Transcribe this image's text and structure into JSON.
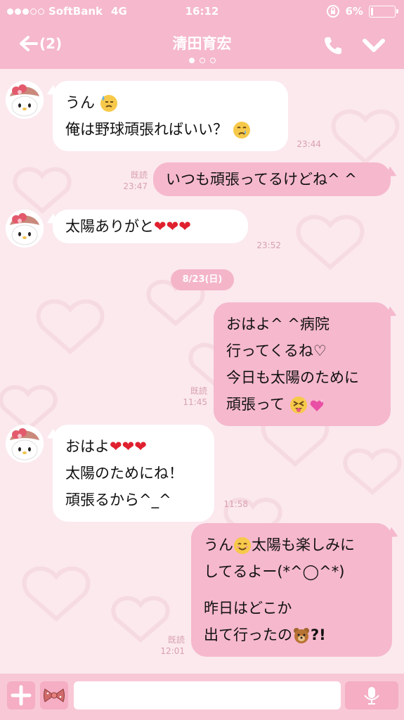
{
  "status_bar": {
    "carrier": "SoftBank",
    "network": "4G",
    "time": "16:12",
    "battery": "6%"
  },
  "nav": {
    "back_label": "(2)",
    "title": "清田育宏"
  },
  "colors": {
    "header": "#f5b8cc",
    "outgoing_bubble": "#f6b8cd",
    "incoming_bubble": "#ffffff",
    "background": "#fbe9ee",
    "meta_text": "#d9a0b0"
  },
  "messages": [
    {
      "direction": "in",
      "lines": [
        "うん",
        "俺は野球頑張ればいい？"
      ],
      "time": "23:44"
    },
    {
      "direction": "out",
      "lines": [
        "いつも頑張ってるけどね^ ^"
      ],
      "read": "既読",
      "time": "23:47"
    },
    {
      "direction": "in",
      "lines": [
        "太陽ありがと"
      ],
      "time": "23:52"
    },
    {
      "date_separator": "8/23(日)"
    },
    {
      "direction": "out",
      "lines": [
        "おはよ^ ^病院",
        "行ってくるね♡",
        "今日も太陽のために",
        "頑張って"
      ],
      "read": "既読",
      "time": "11:45"
    },
    {
      "direction": "in",
      "lines": [
        "おはよ",
        "太陽のためにね！",
        "頑張るから^_^"
      ],
      "time": "11:58"
    },
    {
      "direction": "out",
      "lines": [
        "うん",
        "太陽も楽しみに",
        "してるよー(*^◯^*)",
        "昨日はどこか",
        "出て行ったの",
        "?!"
      ],
      "read": "既読",
      "time": "12:01"
    }
  ],
  "input": {
    "placeholder": ""
  }
}
